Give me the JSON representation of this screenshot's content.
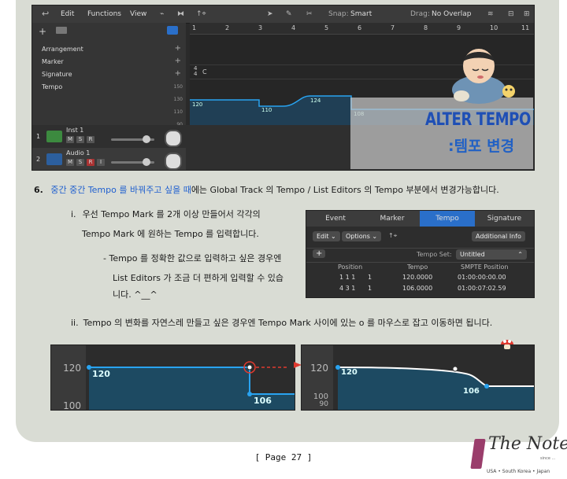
{
  "logic": {
    "toolbar": {
      "edit": "Edit",
      "functions": "Functions",
      "view": "View",
      "snap_label": "Snap:",
      "snap_value": "Smart",
      "drag_label": "Drag:",
      "drag_value": "No Overlap"
    },
    "global_tracks": [
      "Arrangement",
      "Marker",
      "Signature",
      "Tempo"
    ],
    "ruler": [
      "1",
      "2",
      "3",
      "4",
      "5",
      "6",
      "7",
      "8",
      "9",
      "10",
      "11"
    ],
    "signature_value": "4",
    "signature_sub": "4",
    "signature_key": "C",
    "tempo_axis": [
      "150",
      "130",
      "110",
      "90"
    ],
    "tempo_values": [
      "120",
      "110",
      "124",
      "108"
    ],
    "tracks": [
      {
        "num": "1",
        "name": "Inst 1",
        "buttons": [
          "M",
          "S",
          "R"
        ]
      },
      {
        "num": "2",
        "name": "Audio 1",
        "buttons": [
          "M",
          "S",
          "R",
          "I"
        ]
      }
    ]
  },
  "overlay": {
    "title": "ALTER TEMPO",
    "subtitle": ":템포 변경"
  },
  "step6": {
    "number": "6.",
    "highlight": "중간 중간 Tempo 를 바꿔주고 싶을 때",
    "rest": "에는 Global Track 의 Tempo / List Editors 의 Tempo 부분에서 변경가능합니다."
  },
  "sub_i": {
    "label": "i.",
    "line1": "우선 Tempo Mark 를 2개 이상 만들어서 각각의",
    "line2": "Tempo Mark 에 원하는 Tempo 를 입력합니다.",
    "note1": "- Tempo 를 정확한 값으로 입력하고 싶은 경우엔",
    "note2": "List Editors 가 조금 더 편하게 입력할 수 있습",
    "note3": "니다. ^__^"
  },
  "list_editor": {
    "tabs": [
      "Event",
      "Marker",
      "Tempo",
      "Signature"
    ],
    "edit": "Edit",
    "options": "Options",
    "additional_info": "Additional Info",
    "tempo_set_label": "Tempo Set:",
    "tempo_set_value": "Untitled",
    "columns": [
      "Position",
      "Tempo",
      "SMPTE Position"
    ],
    "rows": [
      {
        "pos": "1 1 1",
        "beat": "1",
        "tempo": "120.0000",
        "smpte": "01:00:00:00.00"
      },
      {
        "pos": "4 3 1",
        "beat": "1",
        "tempo": "106.0000",
        "smpte": "01:00:07:02.59"
      }
    ]
  },
  "sub_ii": {
    "label": "ii.",
    "text": "Tempo 의 변화를 자연스레 만들고 싶은 경우엔 Tempo Mark 사이에 있는 o 를 마우스로 잡고 이동하면 됩니다."
  },
  "tempo_before": {
    "axis": [
      "120",
      "100"
    ],
    "values": [
      "120",
      "106"
    ]
  },
  "tempo_after": {
    "axis": [
      "120",
      "100",
      "90"
    ],
    "values": [
      "120",
      "106"
    ]
  },
  "colors": {
    "accent_blue": "#1f5fcf",
    "tempo_line": "#29a3f0",
    "red_marker": "#e03a2f"
  },
  "footer": {
    "page": "[ Page 27 ]"
  },
  "logo": {
    "name": "The Note",
    "tag": "since ...",
    "regions": "USA • South Korea • Japan"
  }
}
